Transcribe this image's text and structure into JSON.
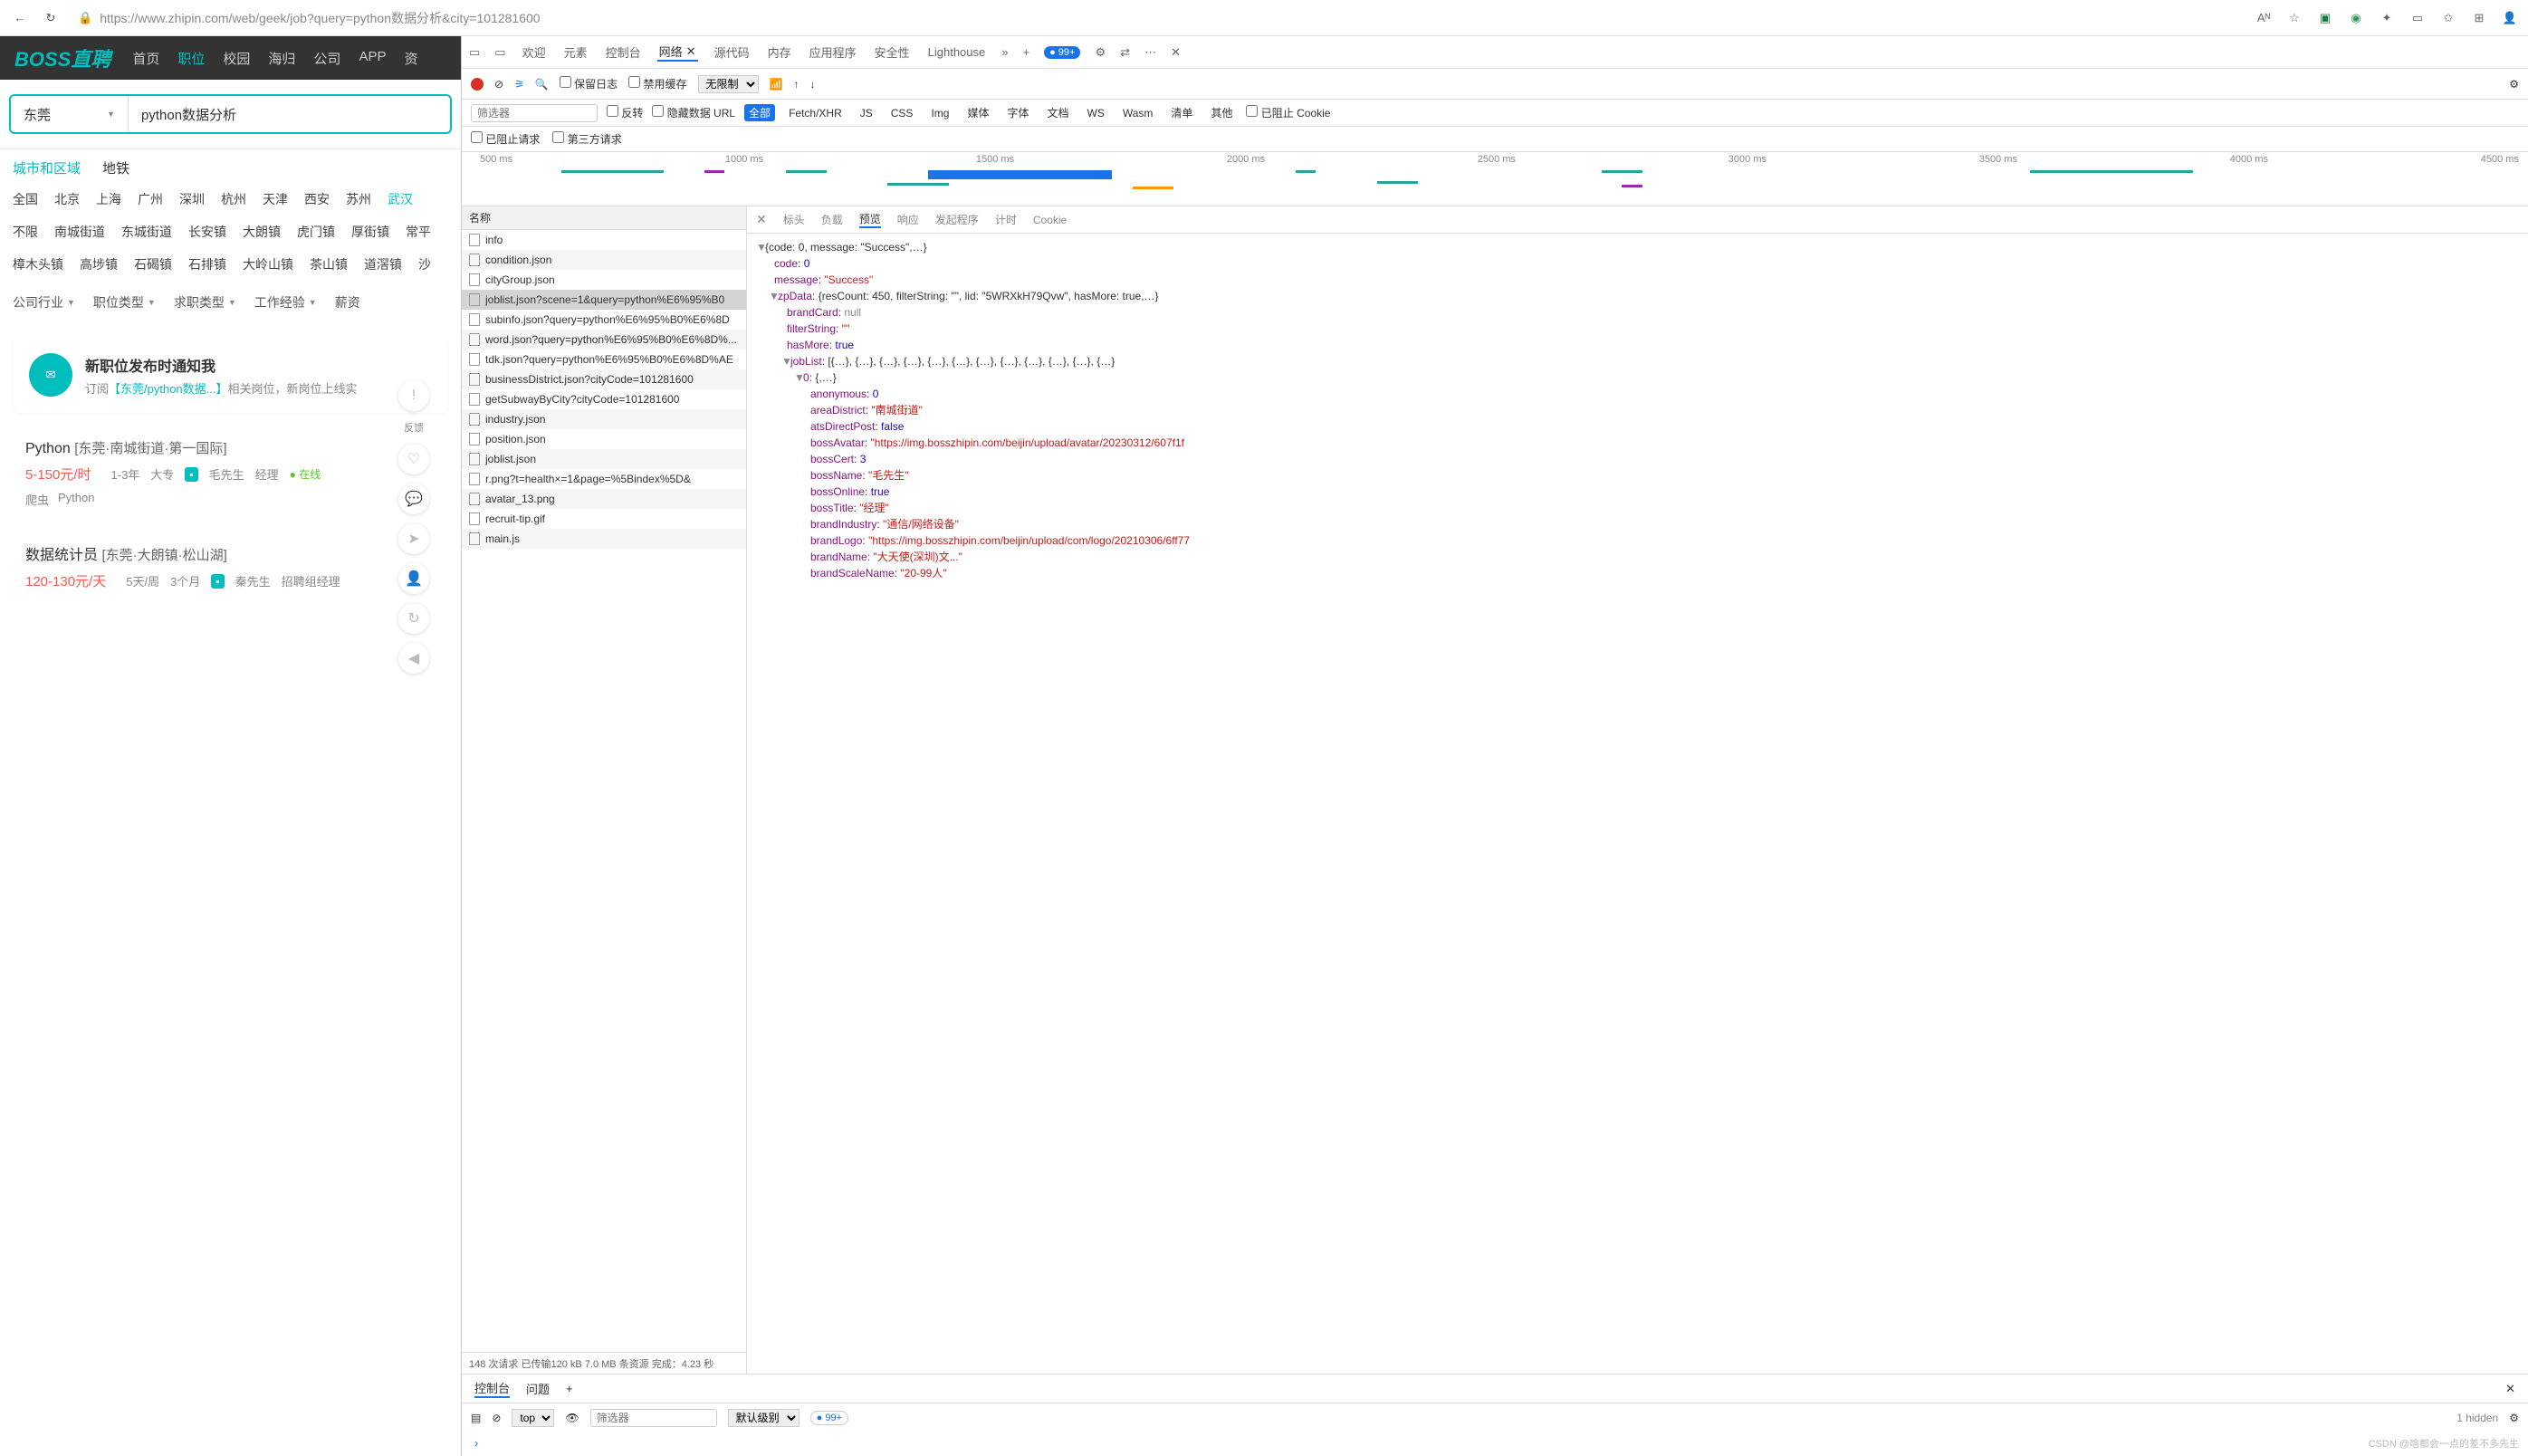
{
  "browser": {
    "url": "https://www.zhipin.com/web/geek/job?query=python数据分析&city=101281600",
    "badge99": "99+"
  },
  "boss": {
    "logo": "BOSS直聘",
    "nav": [
      "首页",
      "职位",
      "校园",
      "海归",
      "公司",
      "APP",
      "资"
    ],
    "activeNav": 1,
    "city": "东莞",
    "searchValue": "python数据分析",
    "locTabs": [
      "城市和区域",
      "地铁"
    ],
    "cities": [
      "全国",
      "北京",
      "上海",
      "广州",
      "深圳",
      "杭州",
      "天津",
      "西安",
      "苏州",
      "武汉"
    ],
    "activeCity": 9,
    "districts1": [
      "不限",
      "南城街道",
      "东城街道",
      "长安镇",
      "大朗镇",
      "虎门镇",
      "厚街镇",
      "常平"
    ],
    "districts2": [
      "樟木头镇",
      "高埗镇",
      "石碣镇",
      "石排镇",
      "大岭山镇",
      "茶山镇",
      "道滘镇",
      "沙"
    ],
    "filters": [
      "公司行业",
      "职位类型",
      "求职类型",
      "工作经验",
      "薪资"
    ],
    "notify": {
      "title": "新职位发布时通知我",
      "sub1": "订阅",
      "link": "【东莞/python数据...】",
      "sub2": "相关岗位，新岗位上线实"
    },
    "job1": {
      "title": "Python",
      "loc": "[东莞·南城街道·第一国际]",
      "salary": "5-150元/时",
      "exp": "1-3年",
      "edu": "大专",
      "boss": "毛先生",
      "bossTitle": "经理",
      "online": "● 在线",
      "skills": [
        "爬虫",
        "Python"
      ]
    },
    "job2": {
      "title": "数据统计员",
      "loc": "[东莞·大朗镇·松山湖]",
      "salary": "120-130元/天",
      "exp": "5天/周",
      "edu": "3个月",
      "boss": "秦先生",
      "bossTitle": "招聘组经理"
    },
    "feedback": "反馈"
  },
  "devtools": {
    "tabs": [
      "欢迎",
      "元素",
      "控制台",
      "网络",
      "源代码",
      "内存",
      "应用程序",
      "安全性",
      "Lighthouse"
    ],
    "closeX": "✕",
    "toolbar": {
      "preserve": "保留日志",
      "disableCache": "禁用缓存",
      "throttle": "无限制"
    },
    "filterPlaceholder": "筛选器",
    "filterOpts": {
      "invert": "反转",
      "hideData": "隐藏数据 URL"
    },
    "types": [
      "全部",
      "Fetch/XHR",
      "JS",
      "CSS",
      "Img",
      "媒体",
      "字体",
      "文档",
      "WS",
      "Wasm",
      "清单",
      "其他"
    ],
    "blocked": "已阻止 Cookie",
    "secondRow": {
      "blocked": "已阻止请求",
      "thirdParty": "第三方请求"
    },
    "timelineTicks": [
      "500 ms",
      "1000 ms",
      "1500 ms",
      "2000 ms",
      "2500 ms",
      "3000 ms",
      "3500 ms",
      "4000 ms",
      "4500 ms"
    ],
    "reqHeader": "名称",
    "requests": [
      "info",
      "condition.json",
      "cityGroup.json",
      "joblist.json?scene=1&query=python%E6%95%B0",
      "subinfo.json?query=python%E6%95%B0%E6%8D",
      "word.json?query=python%E6%95%B0%E6%8D%...",
      "tdk.json?query=python%E6%95%B0%E6%8D%AE",
      "businessDistrict.json?cityCode=101281600",
      "getSubwayByCity?cityCode=101281600",
      "industry.json",
      "position.json",
      "joblist.json",
      "r.png?t=health&times=1&page=%5Bindex%5D&",
      "avatar_13.png",
      "recruit-tip.gif",
      "main.js"
    ],
    "selectedReq": 3,
    "reqStatus": "148 次请求  已传输120 kB  7.0 MB 条资源  完成：4.23 秒",
    "previewTabs": [
      "标头",
      "负载",
      "预览",
      "响应",
      "发起程序",
      "计时",
      "Cookie"
    ],
    "json": {
      "header": "{code: 0, message: \"Success\",…}",
      "code": "0",
      "message": "\"Success\"",
      "zpData": "{resCount: 450, filterString: \"\", lid: \"5WRXkH79Qvw\", hasMore: true,…}",
      "brandCard": "null",
      "filterString": "\"\"",
      "hasMore": "true",
      "jobList": "[{…}, {…}, {…}, {…}, {…}, {…}, {…}, {…}, {…}, {…}, {…}, {…}",
      "item0": "{,…}",
      "anonymous": "0",
      "areaDistrict": "\"南城街道\"",
      "atsDirectPost": "false",
      "bossAvatar": "\"https://img.bosszhipin.com/beijin/upload/avatar/20230312/607f1f",
      "bossCert": "3",
      "bossName": "\"毛先生\"",
      "bossOnline": "true",
      "bossTitle": "\"经理\"",
      "brandIndustry": "\"通信/网络设备\"",
      "brandLogo": "\"https://img.bosszhipin.com/beijin/upload/com/logo/20210306/6ff77",
      "brandName": "\"大天使(深圳)文...\"",
      "brandScaleName": "\"20-99人\""
    },
    "console": {
      "tabs": [
        "控制台",
        "问题"
      ],
      "top": "top",
      "level": "默认级别",
      "badge": "99+",
      "hidden": "1 hidden",
      "prompt": "›"
    }
  },
  "watermark": "CSDN @啥都会一点的差不多先生"
}
